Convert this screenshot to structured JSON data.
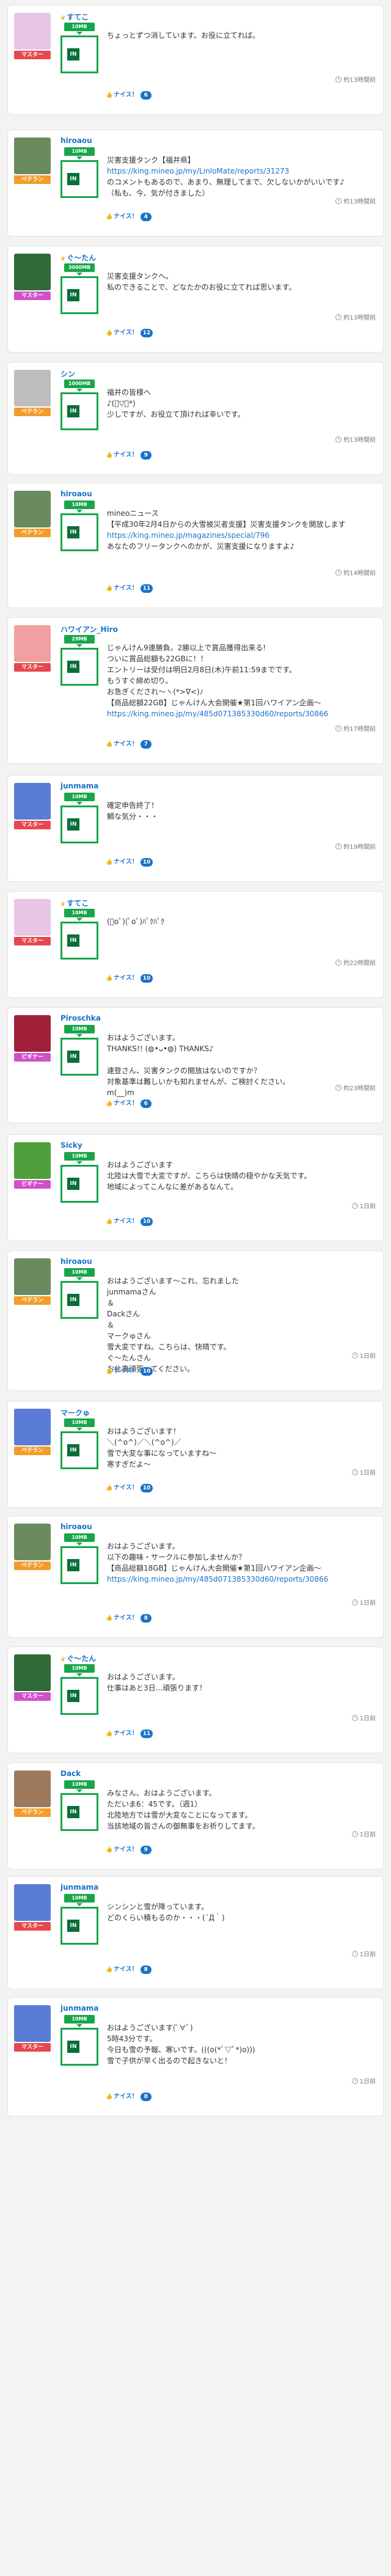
{
  "labels": {
    "nice": "ナイス！",
    "plan": "10MB",
    "box": "IN"
  },
  "posts": [
    {
      "user": "すてこ",
      "crown": true,
      "badge": "マスター",
      "badge_color": "#e5484d",
      "plan": "10MB",
      "msg": "ちょっとずつ消しています。お役に立てれば。",
      "link": "",
      "msg2": "",
      "nice": 6,
      "time": "約13時間前",
      "av": "#e8c6e6"
    },
    {
      "user": "hiroaou",
      "crown": false,
      "badge": "ベテラン",
      "badge_color": "#f39c2b",
      "plan": "10MB",
      "msg": "災害支援タンク【福井県】",
      "link": "https://king.mineo.jp/my/LinloMate/reports/31273",
      "msg2": "のコメントもあるので、あまり、無理してまで、欠しないかがいいです♪\n（私も、今、気が付きました）",
      "nice": 4,
      "time": "約13時間前",
      "av": "#6b8b5e"
    },
    {
      "user": "ぐ〜たん",
      "crown": true,
      "badge": "マスター",
      "badge_color": "#d24fc9",
      "plan": "3000MB",
      "msg": "災害支援タンクへ。\n私のできることで、どなたかのお役に立てれば思います。",
      "link": "",
      "msg2": "",
      "nice": 12,
      "time": "約13時間前",
      "av": "#2e6b36"
    },
    {
      "user": "シン",
      "crown": false,
      "badge": "ベテラン",
      "badge_color": "#f39c2b",
      "plan": "1000MB",
      "msg": "福井の皆様へ\n♪(ﾟ▽ﾟ*)\n少しですが、お役立て頂ければ幸いです。",
      "link": "",
      "msg2": "",
      "nice": 9,
      "time": "約13時間前",
      "av": "#bdbdbd"
    },
    {
      "user": "hiroaou",
      "crown": false,
      "badge": "ベテラン",
      "badge_color": "#f39c2b",
      "plan": "10MB",
      "msg": "mineoニュース\n【平成30年2月4日からの大雪被災者支援】災害支援タンクを開放します",
      "link": "https://king.mineo.jp/magazines/special/796",
      "msg2": "あなたのフリータンクへのかが、災害支援になりますよ♪",
      "nice": 11,
      "time": "約14時間前",
      "av": "#6b8b5e"
    },
    {
      "user": "ハワイアン_Hiro",
      "crown": false,
      "badge": "マスター",
      "badge_color": "#e5484d",
      "plan": "29MB",
      "msg": "じゃんけん9連勝負。2勝以上で賞品獲得出来る!\nついに賞品総額も22GBに！！\nエントリーは受付は明日2月8日(木)午前11:59までです。\nもうすぐ締め切り。\nお急ぎくだされ〜ヽ(*>∇<)ﾉ\n【商品総額22GB】じゃんけん大会開催★第1回ハワイアン企画〜",
      "link": "https://king.mineo.jp/my/485d071385330d60/reports/30866",
      "msg2": "",
      "nice": 7,
      "time": "約17時間前",
      "av": "#f0a0a0"
    },
    {
      "user": "junmama",
      "crown": false,
      "badge": "マスター",
      "badge_color": "#e5484d",
      "plan": "10MB",
      "msg": "確定申告終了！\n鯛な気分・・・",
      "link": "",
      "msg2": "",
      "nice": 10,
      "time": "約19時間前",
      "av": "#5a7bd6"
    },
    {
      "user": "すてこ",
      "crown": true,
      "badge": "マスター",
      "badge_color": "#e5484d",
      "plan": "10MB",
      "msg": "(ﾟoﾟ)(ﾟoﾟ)ﾊﾟｸﾊﾟｸ",
      "link": "",
      "msg2": "",
      "nice": 10,
      "time": "約22時間前",
      "av": "#e8c6e6"
    },
    {
      "user": "Piroschka",
      "crown": false,
      "badge": "ビギナー",
      "badge_color": "#d24fc9",
      "plan": "10MB",
      "msg": "おはようございます。\nTHANKS!! (◍•ᴗ•◍) THANKS♪\n\n連登さん、災害タンクの開放はないのですか？\n対象基準は難しいかも知れませんが、ご検討ください。\nm(__)m",
      "link": "",
      "msg2": "",
      "nice": 6,
      "time": "約23時間前",
      "av": "#a0203a"
    },
    {
      "user": "Sicky",
      "crown": false,
      "badge": "ビギナー",
      "badge_color": "#d24fc9",
      "plan": "10MB",
      "msg": "おはようございます\n北陸は大雪で大変ですが、こちらは快晴の穏やかな天気です。\n地域によってこんなに差があるなんて。",
      "link": "",
      "msg2": "",
      "nice": 10,
      "time": "1日前",
      "av": "#4f9f3c"
    },
    {
      "user": "hiroaou",
      "crown": false,
      "badge": "ベテラン",
      "badge_color": "#f39c2b",
      "plan": "10MB",
      "msg": "おはようございます〜これ、忘れました\njunmamaさん\n＆\nDackさん\n＆\nマークゅさん\n雪大変ですね。こちらは、快晴です。\nぐ〜たんさん\nお仕事頑張ってください。",
      "link": "",
      "msg2": "",
      "nice": 10,
      "time": "1日前",
      "av": "#6b8b5e"
    },
    {
      "user": "マークゅ",
      "crown": false,
      "badge": "ベテラン",
      "badge_color": "#f39c2b",
      "plan": "10MB",
      "msg": "おはようございます！\n＼(^o^)／＼(^o^)／\n雪で大変な事になっていますね〜\n寒すぎだよ〜",
      "link": "",
      "msg2": "",
      "nice": 10,
      "time": "1日前",
      "av": "#5a7bd6"
    },
    {
      "user": "hiroaou",
      "crown": false,
      "badge": "ベテラン",
      "badge_color": "#f39c2b",
      "plan": "10MB",
      "msg": "おはようございます。\n以下の趣味・サークルに参加しませんか？\n【商品総額18GB】じゃんけん大会開催★第1回ハワイアン企画〜",
      "link": "https://king.mineo.jp/my/485d071385330d60/reports/30866",
      "msg2": "",
      "nice": 8,
      "time": "1日前",
      "av": "#6b8b5e"
    },
    {
      "user": "ぐ〜たん",
      "crown": true,
      "badge": "マスター",
      "badge_color": "#d24fc9",
      "plan": "10MB",
      "msg": "おはようございます。\n仕事はあと3日...頑張ります！",
      "link": "",
      "msg2": "",
      "nice": 11,
      "time": "1日前",
      "av": "#2e6b36"
    },
    {
      "user": "Dack",
      "crown": false,
      "badge": "ベテラン",
      "badge_color": "#f39c2b",
      "plan": "10MB",
      "msg": "みなさん、おはようございます。\nただいま6：45です。（週1）\n北陸地方では雪が大変なことになってます。\n当該地域の皆さんの御無事をお祈りしてます。",
      "link": "",
      "msg2": "",
      "nice": 9,
      "time": "1日前",
      "av": "#9c7a5b"
    },
    {
      "user": "junmama",
      "crown": false,
      "badge": "マスター",
      "badge_color": "#e5484d",
      "plan": "10MB",
      "msg": "シンシンと雪が降っています。\nどのくらい積もるのか・・・(´Д｀)",
      "link": "",
      "msg2": "",
      "nice": 8,
      "time": "1日前",
      "av": "#5a7bd6"
    },
    {
      "user": "junmama",
      "crown": false,
      "badge": "マスター",
      "badge_color": "#e5484d",
      "plan": "10MB",
      "msg": "おはようございます(ﾟ∀ﾟ)\n5時43分です。\n今日も雪の予報、寒いです。(((o(*ﾟ▽ﾟ*)o)))\n雪で子供が早く出るので起きないと！",
      "link": "",
      "msg2": "",
      "nice": 8,
      "time": "1日前",
      "av": "#5a7bd6"
    }
  ]
}
